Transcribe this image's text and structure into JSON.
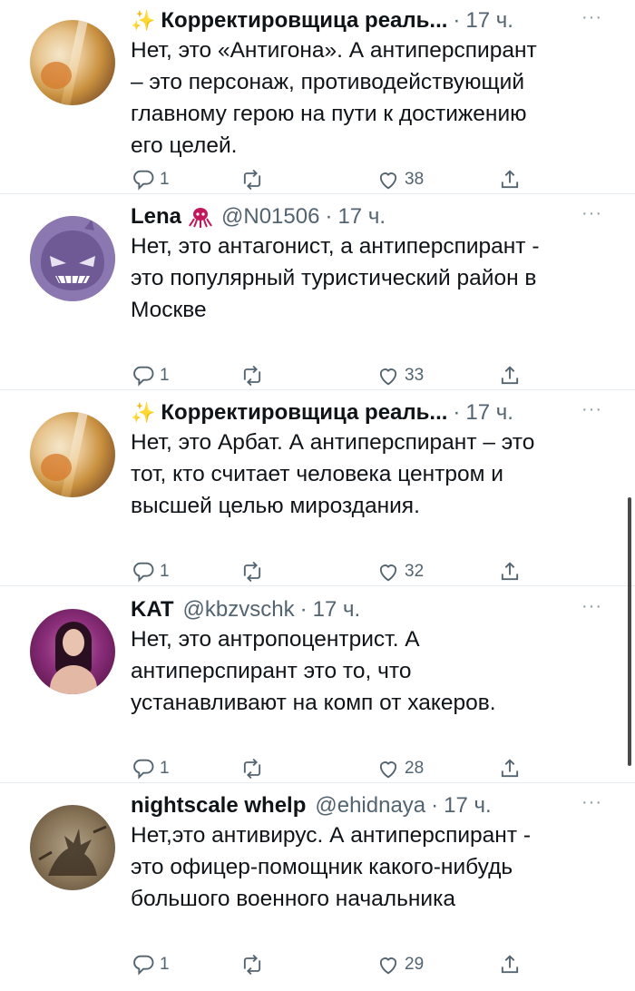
{
  "tweets": [
    {
      "name": "Корректировщица реаль...",
      "handle": "",
      "time": "17 ч.",
      "text": "Нет, это «Антигона». А антиперспирант\n– это персонаж, противодействующий\nглавному герою на пути к достижению\nего целей.",
      "replies": "1",
      "retweets": "",
      "likes": "38"
    },
    {
      "name": "Lena",
      "handle": "@N01506",
      "time": "17 ч.",
      "text": "Нет, это антагонист, а антиперспирант -\nэто популярный туристический район в\nМоскве",
      "replies": "1",
      "retweets": "",
      "likes": "33"
    },
    {
      "name": "Корректировщица реаль...",
      "handle": "",
      "time": "17 ч.",
      "text": "Нет, это Арбат. А антиперспирант – это\nтот, кто считает человека центром и\nвысшей целью мироздания.",
      "replies": "1",
      "retweets": "",
      "likes": "32"
    },
    {
      "name": "KAT",
      "handle": "@kbzvschk",
      "time": "17 ч.",
      "text": "Нет, это антропоцентрист. А\nантиперспирант это то, что\nустанавливают на комп от хакеров.",
      "replies": "1",
      "retweets": "",
      "likes": "28"
    },
    {
      "name": "nightscale whelp",
      "handle": "@ehidnaya",
      "time": "17 ч.",
      "text": "Нет,это антивирус. А антиперспирант  -\nэто офицер-помощник какого-нибудь\nбольшого военного начальника",
      "replies": "1",
      "retweets": "",
      "likes": "29"
    }
  ],
  "ui": {
    "more_label": "···",
    "dot": "·",
    "sparkle": "✨",
    "icons": {
      "reply": "reply-icon",
      "retweet": "retweet-icon",
      "like": "heart-icon",
      "share": "share-icon",
      "more": "more-horizontal-icon"
    },
    "colors": {
      "text": "#0f1419",
      "secondary": "#536471",
      "separator": "#e6ecf0"
    }
  }
}
